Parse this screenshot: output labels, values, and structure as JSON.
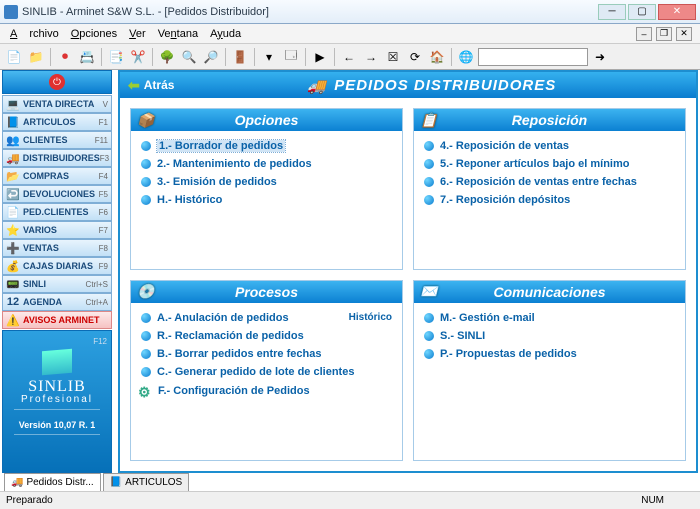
{
  "window": {
    "title": "SINLIB - Arminet S&W S.L. - [Pedidos Distribuidor]"
  },
  "menu": {
    "archivo": "Archivo",
    "opciones": "Opciones",
    "ver": "Ver",
    "ventana": "Ventana",
    "ayuda": "Ayuda"
  },
  "sidebar": {
    "items": [
      {
        "icon": "💻",
        "label": "VENTA DIRECTA",
        "key": "V"
      },
      {
        "icon": "📘",
        "label": "ARTICULOS",
        "key": "F1"
      },
      {
        "icon": "👥",
        "label": "CLIENTES",
        "key": "F11"
      },
      {
        "icon": "🚚",
        "label": "DISTRIBUIDORES",
        "key": "F3"
      },
      {
        "icon": "📂",
        "label": "COMPRAS",
        "key": "F4"
      },
      {
        "icon": "↩️",
        "label": "DEVOLUCIONES",
        "key": "F5"
      },
      {
        "icon": "📄",
        "label": "PED.CLIENTES",
        "key": "F6"
      },
      {
        "icon": "⭐",
        "label": "VARIOS",
        "key": "F7"
      },
      {
        "icon": "➕",
        "label": "VENTAS",
        "key": "F8"
      },
      {
        "icon": "💰",
        "label": "CAJAS DIARIAS",
        "key": "F9"
      },
      {
        "icon": "📟",
        "label": "SINLI",
        "key": "Ctrl+S"
      },
      {
        "icon": "12",
        "label": "AGENDA",
        "key": "Ctrl+A"
      },
      {
        "icon": "⚠️",
        "label": "AVISOS ARMINET",
        "key": "",
        "alert": true
      }
    ],
    "logo": {
      "key": "F12",
      "line1": "SINLIB",
      "line2": "Profesional",
      "version": "Versión 10,07 R. 1"
    }
  },
  "main": {
    "back": "Atrás",
    "title": "PEDIDOS DISTRIBUIDORES",
    "panels": [
      {
        "id": "opciones",
        "icon": "📦",
        "title": "Opciones",
        "rows": [
          {
            "label": "1.- Borrador de pedidos",
            "selected": true
          },
          {
            "label": "2.- Mantenimiento de pedidos"
          },
          {
            "label": "3.- Emisión de pedidos"
          },
          {
            "label": "H.- Histórico"
          }
        ]
      },
      {
        "id": "reposicion",
        "icon": "📋",
        "title": "Reposición",
        "rows": [
          {
            "label": "4.- Reposición de ventas"
          },
          {
            "label": "5.- Reponer artículos bajo el mínimo"
          },
          {
            "label": "6.- Reposición de ventas entre fechas"
          },
          {
            "label": "7.- Reposición depósitos"
          }
        ]
      },
      {
        "id": "procesos",
        "icon": "💿",
        "title": "Procesos",
        "rows": [
          {
            "label": "A.- Anulación de pedidos",
            "extra": "Histórico"
          },
          {
            "label": "R.- Reclamación de pedidos"
          },
          {
            "label": "B.- Borrar pedidos entre fechas"
          },
          {
            "label": "C.- Generar pedido de lote de clientes"
          },
          {
            "label": "F.- Configuración de Pedidos",
            "gear": true
          }
        ]
      },
      {
        "id": "comunicaciones",
        "icon": "✉️",
        "title": "Comunicaciones",
        "rows": [
          {
            "label": "M.- Gestión e-mail"
          },
          {
            "label": "S.- SINLI"
          },
          {
            "label": "P.- Propuestas de pedidos"
          }
        ]
      }
    ]
  },
  "footerTabs": [
    {
      "icon": "🚚",
      "label": "Pedidos Distr..."
    },
    {
      "icon": "📘",
      "label": "ARTICULOS"
    }
  ],
  "status": {
    "left": "Preparado",
    "right": "NUM"
  }
}
